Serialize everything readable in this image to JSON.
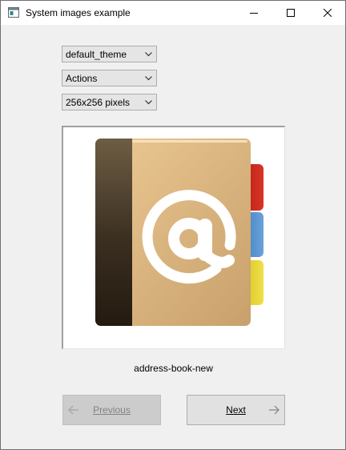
{
  "window": {
    "title": "System images example"
  },
  "controls": {
    "theme_value": "default_theme",
    "category_value": "Actions",
    "size_value": "256x256 pixels"
  },
  "image": {
    "icon": "address-book-new",
    "caption": "address-book-new"
  },
  "navigation": {
    "previous_label": "Previous",
    "previous_enabled": false,
    "next_label": "Next",
    "next_enabled": true
  }
}
